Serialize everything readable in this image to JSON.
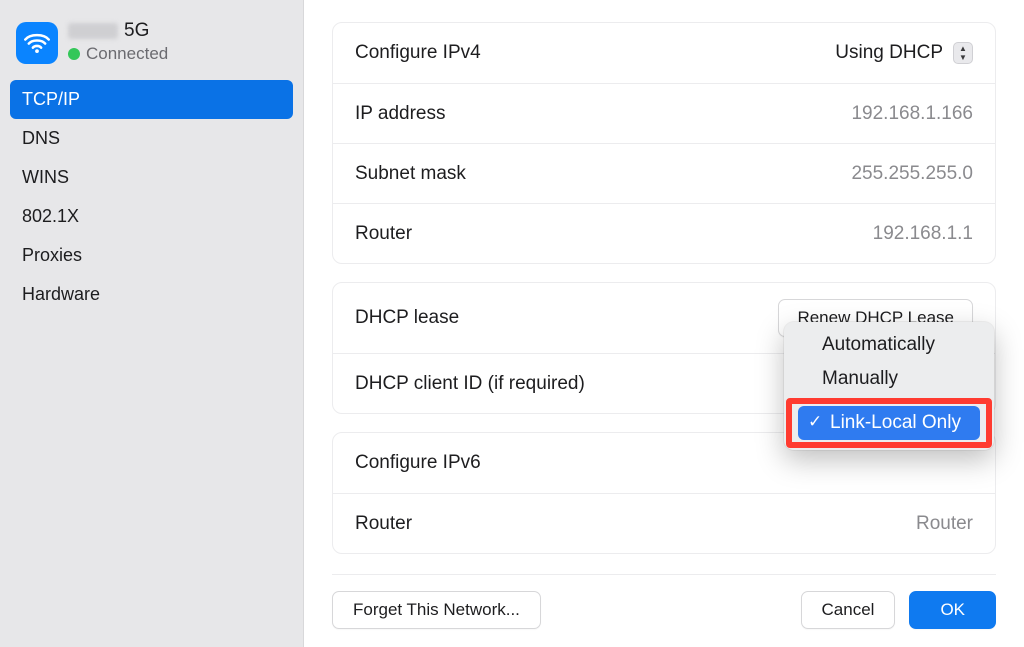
{
  "sidebar": {
    "network_name_suffix": "5G",
    "status": "Connected",
    "items": [
      {
        "label": "TCP/IP"
      },
      {
        "label": "DNS"
      },
      {
        "label": "WINS"
      },
      {
        "label": "802.1X"
      },
      {
        "label": "Proxies"
      },
      {
        "label": "Hardware"
      }
    ],
    "active_index": 0
  },
  "ipv4": {
    "configure_label": "Configure IPv4",
    "configure_value": "Using DHCP",
    "ip_label": "IP address",
    "ip_value": "192.168.1.166",
    "subnet_label": "Subnet mask",
    "subnet_value": "255.255.255.0",
    "router_label": "Router",
    "router_value": "192.168.1.1"
  },
  "dhcp": {
    "lease_label": "DHCP lease",
    "renew_button": "Renew DHCP Lease",
    "client_id_label": "DHCP client ID (if required)"
  },
  "ipv6": {
    "configure_label": "Configure IPv6",
    "router_label": "Router",
    "router_value": "Router",
    "options": [
      {
        "label": "Automatically",
        "selected": false
      },
      {
        "label": "Manually",
        "selected": false
      },
      {
        "label": "Link-Local Only",
        "selected": true
      }
    ]
  },
  "footer": {
    "forget": "Forget This Network...",
    "cancel": "Cancel",
    "ok": "OK"
  }
}
